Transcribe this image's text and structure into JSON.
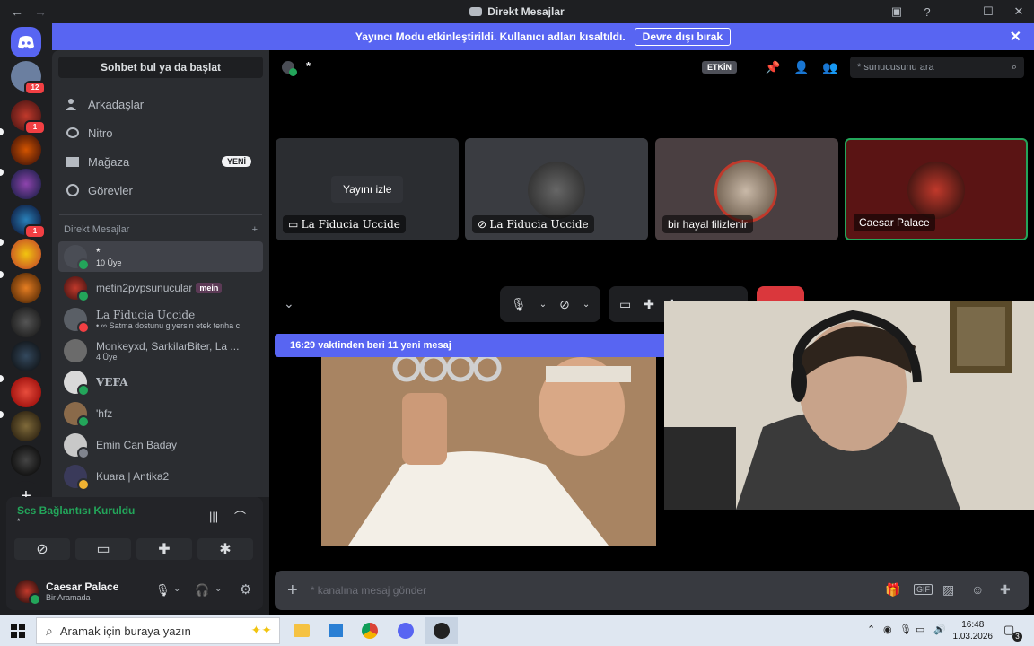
{
  "window": {
    "title": "Direkt Mesajlar"
  },
  "banner": {
    "text": "Yayıncı Modu etkinleştirildi. Kullanıcı adları kısaltıldı.",
    "button": "Devre dışı bırak"
  },
  "servers": {
    "home_badge": "12",
    "items": [
      {
        "badge": "1"
      },
      {
        "badge": ""
      },
      {
        "badge": ""
      },
      {
        "badge": "1"
      },
      {
        "badge": ""
      },
      {
        "badge": ""
      },
      {
        "badge": ""
      },
      {
        "badge": ""
      },
      {
        "badge": ""
      },
      {
        "badge": ""
      }
    ]
  },
  "sidebar": {
    "search_label": "Sohbet bul ya da başlat",
    "nav": [
      "Arkadaşlar",
      "Nitro",
      "Mağaza",
      "Görevler"
    ],
    "new_badge": "YENİ",
    "dm_header": "Direkt Mesajlar",
    "dms": [
      {
        "name": "*",
        "sub": "10 Üye"
      },
      {
        "name": "metin2pvpsunucular",
        "tag": "mein"
      },
      {
        "name": "La Fiducia Uccide",
        "sub": "• ∞  Satma dostunu giyersin etek tenha c"
      },
      {
        "name": "Monkeyxd, SarkilarBiter, La ...",
        "sub": "4 Üye"
      },
      {
        "name": "VEFA"
      },
      {
        "name": "'hfz"
      },
      {
        "name": "Emin Can Baday"
      },
      {
        "name": "Kuara | Antika2"
      }
    ]
  },
  "voice_panel": {
    "status": "Ses Bağlantısı Kuruldu",
    "channel": "*",
    "user_name": "Caesar Palace",
    "user_status": "Bir Aramada"
  },
  "channel": {
    "name": "*",
    "etkin": "ETKİN",
    "search_placeholder": "* sunucusunu ara",
    "watch_stream": "Yayını izle",
    "tiles": [
      "La Fiducia Uccide",
      "La Fiducia Uccide",
      "bir hayal filizlenir",
      "Caesar Palace"
    ],
    "new_messages": "16:29 vaktinden beri 11 yeni mesaj",
    "message_placeholder": "* kanalına mesaj gönder"
  },
  "taskbar": {
    "search_placeholder": "Aramak için buraya yazın",
    "time": "16:48",
    "date": "1.03.2026",
    "notif_count": "3"
  },
  "colors": {
    "blurple": "#5865f2",
    "online": "#23a55a",
    "danger": "#f23f43",
    "sidebar": "#2b2d31"
  }
}
